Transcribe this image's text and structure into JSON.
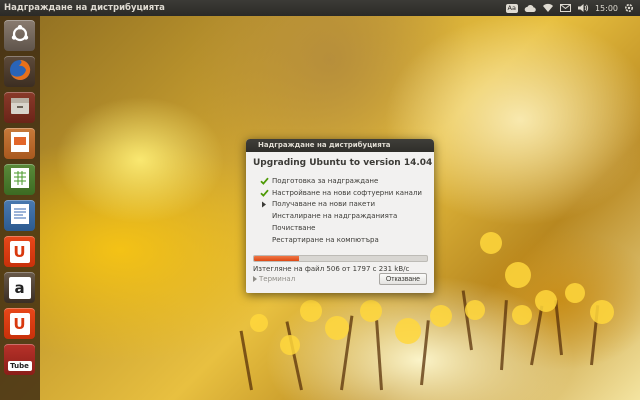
{
  "top_panel": {
    "title": "Надграждане на дистрибуцията",
    "keyboard_indicator": "Aa",
    "clock": "15:00",
    "icons": [
      "keyboard-layout-icon",
      "cloud-sync-icon",
      "wifi-icon",
      "mail-icon",
      "volume-icon",
      "power-gear-icon"
    ]
  },
  "launcher": {
    "items": [
      {
        "name": "ubuntu-dash",
        "icon": "ubuntu-logo-icon"
      },
      {
        "name": "firefox",
        "icon": "firefox-icon"
      },
      {
        "name": "files",
        "icon": "file-cabinet-icon"
      },
      {
        "name": "impress",
        "icon": "presentation-icon"
      },
      {
        "name": "calc",
        "icon": "spreadsheet-icon"
      },
      {
        "name": "writer",
        "icon": "document-icon"
      },
      {
        "name": "ubuntu-one",
        "icon": "ubuntu-one-icon",
        "label": "U"
      },
      {
        "name": "amazon",
        "icon": "amazon-icon",
        "label": "a"
      },
      {
        "name": "ubuntu-one-music",
        "icon": "ubuntu-one-music-icon",
        "label": "U"
      },
      {
        "name": "tube",
        "icon": "tube-icon",
        "label": "Tube"
      }
    ]
  },
  "dialog": {
    "title": "Надграждане на дистрибуцията",
    "heading": "Upgrading Ubuntu to version 14.04",
    "steps": [
      {
        "label": "Подготовка за надграждане",
        "state": "done"
      },
      {
        "label": "Настройване на нови софтуерни канали",
        "state": "done"
      },
      {
        "label": "Получаване на нови пакети",
        "state": "current"
      },
      {
        "label": "Инсталиране на надгражданията",
        "state": "pending"
      },
      {
        "label": "Почистване",
        "state": "pending"
      },
      {
        "label": "Рестартиране на компютъра",
        "state": "pending"
      }
    ],
    "progress_fraction": 0.26,
    "status": "Изтегляне на файл 506 от 1797 с 231 kB/с",
    "terminal_label": "Терминал",
    "cancel_label": "Отказване"
  },
  "colors": {
    "accent": "#dd4814",
    "check": "#4e9a06",
    "panel": "#3c3b37"
  }
}
